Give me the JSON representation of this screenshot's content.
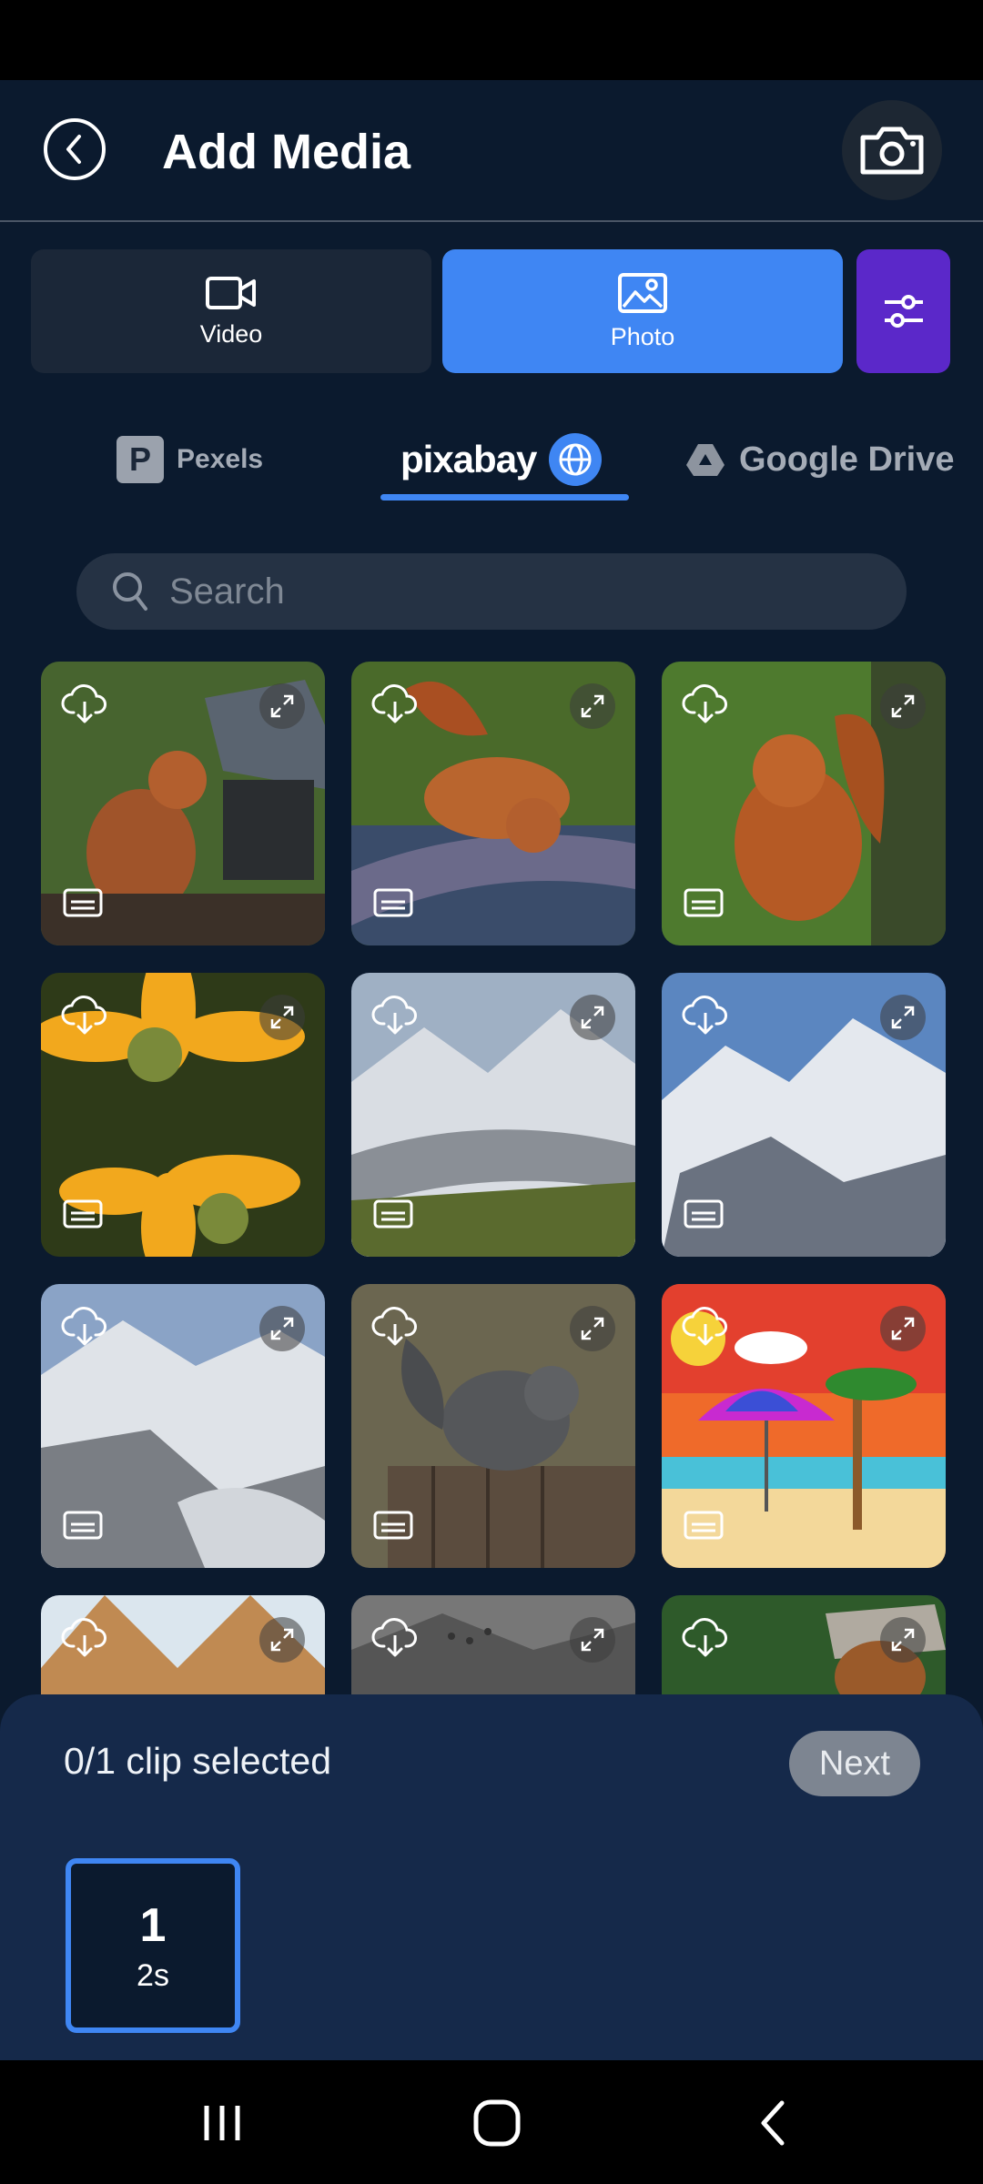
{
  "header": {
    "title": "Add Media"
  },
  "media_types": [
    {
      "label": "Video",
      "active": false
    },
    {
      "label": "Photo",
      "active": true
    }
  ],
  "sources": {
    "pexels": "Pexels",
    "pixabay": "pixabay",
    "google_drive": "Google Drive",
    "active": "pixabay"
  },
  "search": {
    "placeholder": "Search",
    "value": ""
  },
  "grid": {
    "tiles": [
      {
        "subject": "red squirrel on bird feeder"
      },
      {
        "subject": "red squirrel drinking water"
      },
      {
        "subject": "red squirrel sitting"
      },
      {
        "subject": "yellow flowers"
      },
      {
        "subject": "mountain glacier"
      },
      {
        "subject": "snowy mountains"
      },
      {
        "subject": "glacier valley"
      },
      {
        "subject": "grey squirrel on fence"
      },
      {
        "subject": "beach umbrella illustration"
      },
      {
        "subject": "pyramids"
      },
      {
        "subject": "birds over misty mountains"
      },
      {
        "subject": "squirrel in birdhouse"
      }
    ]
  },
  "selection": {
    "status": "0/1 clip selected",
    "next_label": "Next",
    "clips": [
      {
        "number": "1",
        "duration": "2s"
      }
    ]
  },
  "colors": {
    "background": "#0b1a2e",
    "accent": "#3f86f3",
    "filter": "#5b28c9",
    "panel": "#15294a"
  }
}
